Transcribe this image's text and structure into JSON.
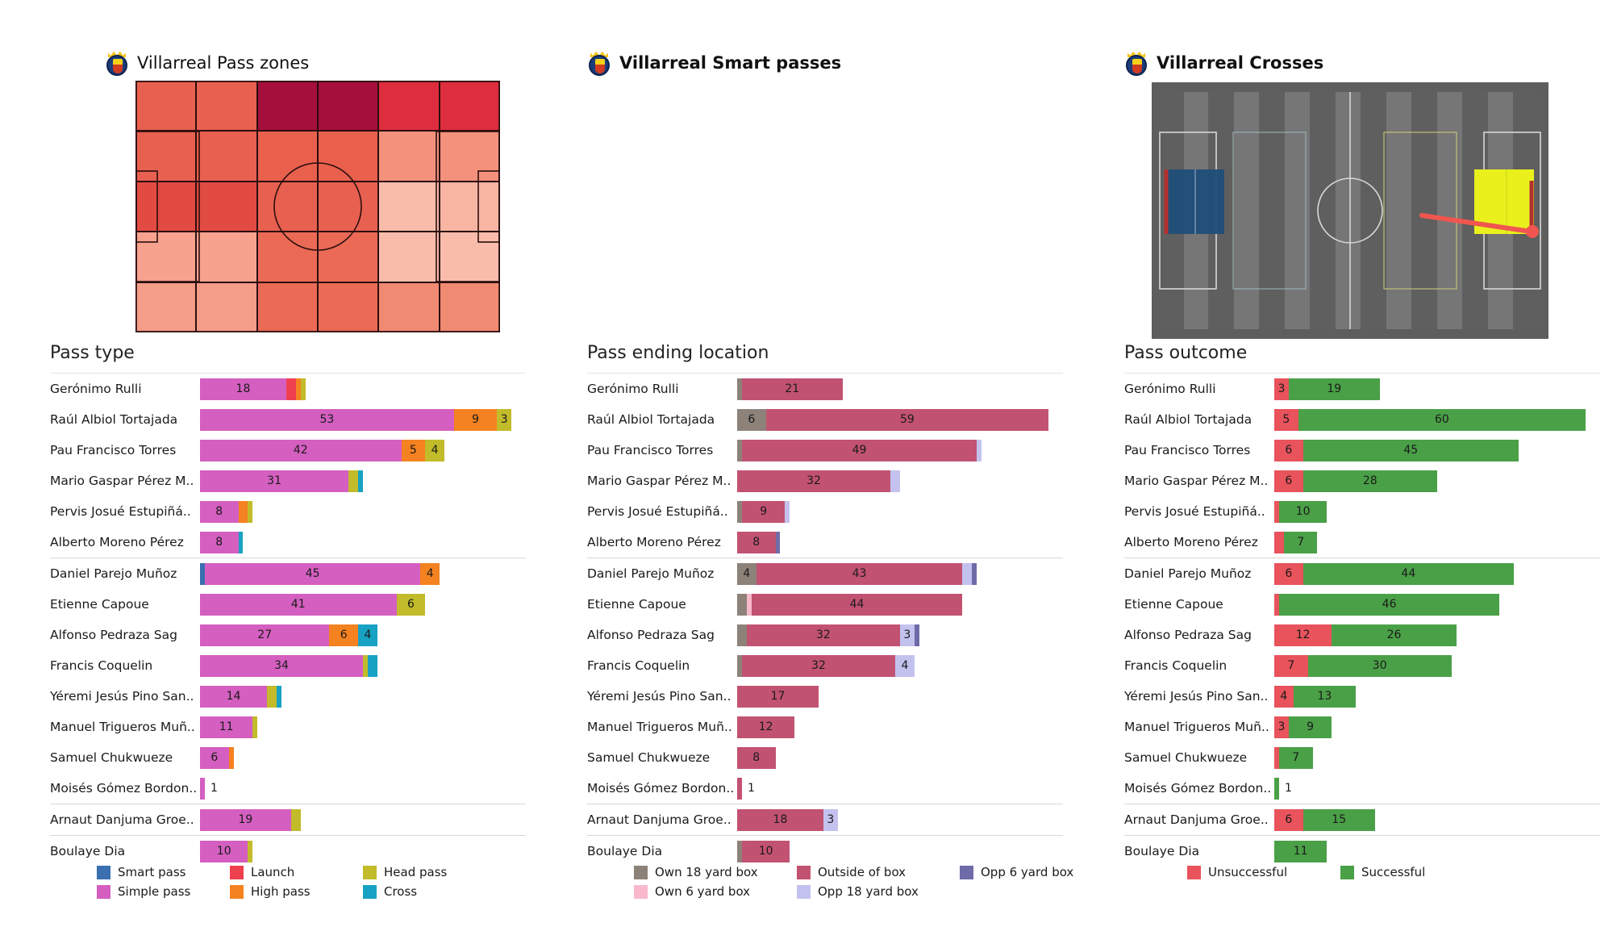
{
  "panels": [
    {
      "title": "Villarreal Pass zones",
      "bold": false,
      "section": "Pass type"
    },
    {
      "title": "Villarreal Smart passes",
      "bold": true,
      "section": "Pass ending location"
    },
    {
      "title": "Villarreal Crosses",
      "bold": true,
      "section": "Pass outcome"
    }
  ],
  "players": [
    "Gerónimo Rulli",
    "Raúl Albiol Tortajada",
    "Pau Francisco Torres",
    "Mario Gaspar Pérez M..",
    "Pervis Josué Estupiñá..",
    "Alberto Moreno Pérez",
    "Daniel Parejo Muñoz",
    "Etienne Capoue",
    "Alfonso Pedraza Sag",
    "Francis Coquelin",
    "Yéremi Jesús Pino San..",
    "Manuel Trigueros Muñ..",
    "Samuel Chukwueze",
    "Moisés Gómez Bordon..",
    "Arnaut Danjuma Groe..",
    "Boulaye Dia"
  ],
  "group_breaks": [
    6,
    14,
    15
  ],
  "colors": {
    "smart_pass": "#3a6fb0",
    "simple_pass": "#d45fc0",
    "launch": "#ef4050",
    "high_pass": "#f58220",
    "head_pass": "#c2bb2a",
    "cross": "#17a2c4",
    "own18": "#8d8279",
    "own6": "#f9b9cb",
    "outside": "#c25272",
    "opp18": "#c3c2ee",
    "opp6": "#6f6aa8",
    "unsuccessful": "#e8535c",
    "successful": "#4aa047"
  },
  "chart_data": [
    {
      "type": "bar",
      "title": "Pass type",
      "stacked": true,
      "orientation": "horizontal",
      "categories": [
        "Gerónimo Rulli",
        "Raúl Albiol Tortajada",
        "Pau Francisco Torres",
        "Mario Gaspar Pérez M..",
        "Pervis Josué Estupiñá..",
        "Alberto Moreno Pérez",
        "Daniel Parejo Muñoz",
        "Etienne Capoue",
        "Alfonso Pedraza Sag",
        "Francis Coquelin",
        "Yéremi Jesús Pino San..",
        "Manuel Trigueros Muñ..",
        "Samuel Chukwueze",
        "Moisés Gómez Bordon..",
        "Arnaut Danjuma Groe..",
        "Boulaye Dia"
      ],
      "series": [
        {
          "name": "Smart pass",
          "values": [
            0,
            0,
            0,
            0,
            0,
            0,
            1,
            0,
            0,
            0,
            0,
            0,
            0,
            0,
            0,
            0
          ]
        },
        {
          "name": "Simple pass",
          "values": [
            18,
            53,
            42,
            31,
            8,
            8,
            45,
            41,
            27,
            34,
            14,
            11,
            6,
            1,
            19,
            10
          ]
        },
        {
          "name": "Launch",
          "values": [
            2,
            0,
            0,
            0,
            0,
            0,
            0,
            0,
            0,
            0,
            0,
            0,
            0,
            0,
            0,
            0
          ]
        },
        {
          "name": "High pass",
          "values": [
            1,
            9,
            5,
            0,
            2,
            0,
            4,
            0,
            6,
            0,
            0,
            0,
            1,
            0,
            0,
            0
          ]
        },
        {
          "name": "Head pass",
          "values": [
            1,
            3,
            4,
            2,
            1,
            0,
            0,
            6,
            0,
            1,
            2,
            1,
            0,
            0,
            2,
            1
          ]
        },
        {
          "name": "Cross",
          "values": [
            0,
            0,
            0,
            1,
            0,
            1,
            0,
            0,
            4,
            2,
            1,
            0,
            0,
            0,
            0,
            0
          ]
        }
      ],
      "xlim": [
        0,
        68
      ],
      "legend": [
        {
          "label": "Smart pass",
          "color": "#3a6fb0"
        },
        {
          "label": "Simple pass",
          "color": "#d45fc0"
        },
        {
          "label": "Launch",
          "color": "#ef4050"
        },
        {
          "label": "High pass",
          "color": "#f58220"
        },
        {
          "label": "Head pass",
          "color": "#c2bb2a"
        },
        {
          "label": "Cross",
          "color": "#17a2c4"
        }
      ]
    },
    {
      "type": "bar",
      "title": "Pass ending location",
      "stacked": true,
      "orientation": "horizontal",
      "categories": [
        "Gerónimo Rulli",
        "Raúl Albiol Tortajada",
        "Pau Francisco Torres",
        "Mario Gaspar Pérez M..",
        "Pervis Josué Estupiñá..",
        "Alberto Moreno Pérez",
        "Daniel Parejo Muñoz",
        "Etienne Capoue",
        "Alfonso Pedraza Sag",
        "Francis Coquelin",
        "Yéremi Jesús Pino San..",
        "Manuel Trigueros Muñ..",
        "Samuel Chukwueze",
        "Moisés Gómez Bordon..",
        "Arnaut Danjuma Groe..",
        "Boulaye Dia"
      ],
      "series": [
        {
          "name": "Own 18 yard box",
          "values": [
            1,
            6,
            1,
            0,
            1,
            0,
            4,
            2,
            2,
            1,
            0,
            0,
            0,
            0,
            0,
            1
          ]
        },
        {
          "name": "Own 6 yard box",
          "values": [
            0,
            0,
            0,
            0,
            0,
            0,
            0,
            1,
            0,
            0,
            0,
            0,
            0,
            0,
            0,
            0
          ]
        },
        {
          "name": "Outside of box",
          "values": [
            21,
            59,
            49,
            32,
            9,
            8,
            43,
            44,
            32,
            32,
            17,
            12,
            8,
            1,
            18,
            10
          ]
        },
        {
          "name": "Opp 18 yard box",
          "values": [
            0,
            0,
            1,
            2,
            1,
            0,
            2,
            0,
            3,
            4,
            0,
            0,
            0,
            0,
            3,
            0
          ]
        },
        {
          "name": "Opp 6 yard box",
          "values": [
            0,
            0,
            0,
            0,
            0,
            1,
            1,
            0,
            1,
            0,
            0,
            0,
            0,
            0,
            0,
            0
          ]
        }
      ],
      "xlim": [
        0,
        68
      ],
      "legend": [
        {
          "label": "Own 18 yard box",
          "color": "#8d8279"
        },
        {
          "label": "Own 6 yard box",
          "color": "#f9b9cb"
        },
        {
          "label": "Outside of box",
          "color": "#c25272"
        },
        {
          "label": "Opp 18 yard box",
          "color": "#c3c2ee"
        },
        {
          "label": "Opp 6 yard box",
          "color": "#6f6aa8"
        }
      ]
    },
    {
      "type": "bar",
      "title": "Pass outcome",
      "stacked": true,
      "orientation": "horizontal",
      "categories": [
        "Gerónimo Rulli",
        "Raúl Albiol Tortajada",
        "Pau Francisco Torres",
        "Mario Gaspar Pérez M..",
        "Pervis Josué Estupiñá..",
        "Alberto Moreno Pérez",
        "Daniel Parejo Muñoz",
        "Etienne Capoue",
        "Alfonso Pedraza Sag",
        "Francis Coquelin",
        "Yéremi Jesús Pino San..",
        "Manuel Trigueros Muñ..",
        "Samuel Chukwueze",
        "Moisés Gómez Bordon..",
        "Arnaut Danjuma Groe..",
        "Boulaye Dia"
      ],
      "series": [
        {
          "name": "Unsuccessful",
          "values": [
            3,
            5,
            6,
            6,
            1,
            2,
            6,
            1,
            12,
            7,
            4,
            3,
            1,
            0,
            6,
            0
          ]
        },
        {
          "name": "Successful",
          "values": [
            19,
            60,
            45,
            28,
            10,
            7,
            44,
            46,
            26,
            30,
            13,
            9,
            7,
            1,
            15,
            11
          ]
        }
      ],
      "xlim": [
        0,
        68
      ],
      "legend": [
        {
          "label": "Unsuccessful",
          "color": "#e8535c"
        },
        {
          "label": "Successful",
          "color": "#4aa047"
        }
      ]
    }
  ],
  "pass_zones": {
    "cols": 6,
    "rows": 5,
    "cells": [
      "#e8604f",
      "#e8604f",
      "#a50f3c",
      "#a50f3c",
      "#de2d3e",
      "#de2d3e",
      "#e8604f",
      "#e8604f",
      "#e9604d",
      "#e9604d",
      "#f3917c",
      "#f3917c",
      "#e14b42",
      "#e14b42",
      "#e8604f",
      "#e8604f",
      "#f9bcab",
      "#f8b5a2",
      "#f6a28e",
      "#f6a28e",
      "#ea6a55",
      "#ea6a55",
      "#f9bcab",
      "#f9bcab",
      "#f49d88",
      "#f49d88",
      "#ea6a55",
      "#ea6a55",
      "#f08a72",
      "#f08a72"
    ]
  }
}
